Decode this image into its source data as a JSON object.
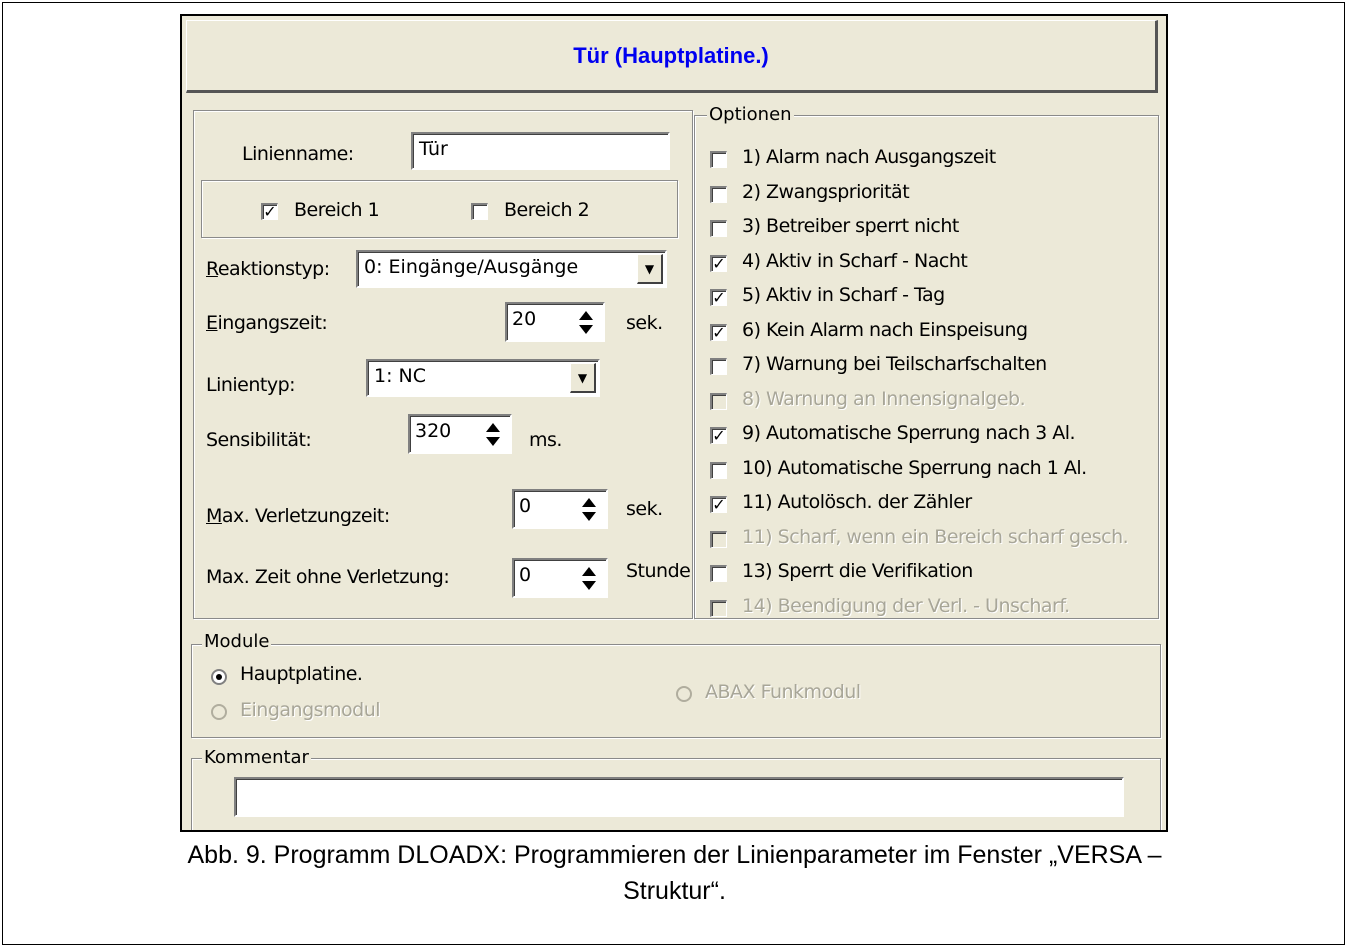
{
  "dialog": {
    "title": "Tür (Hauptplatine.)",
    "left": {
      "name_label": "Linienname:",
      "name_value": "Tür",
      "area1_label": "Bereich 1",
      "area1_checked": true,
      "area2_label": "Bereich 2",
      "area2_checked": false,
      "reaction_label_u": "R",
      "reaction_label_rest": "eaktionstyp:",
      "reaction_value": "0: Eingänge/Ausgänge",
      "entry_label_u": "E",
      "entry_label_rest": "ingangszeit:",
      "entry_value": "20",
      "entry_unit": "sek.",
      "linetype_label": "Linientyp:",
      "linetype_value": "1: NC",
      "sens_label": "Sensibilität:",
      "sens_value": "320",
      "sens_unit": "ms.",
      "maxviol_label_u": "M",
      "maxviol_label_rest": "ax. Verletzungzeit:",
      "maxviol_value": "0",
      "maxviol_unit": "sek.",
      "maxnoviol_label": "Max. Zeit ohne Verletzung:",
      "maxnoviol_value": "0",
      "maxnoviol_unit": "Stunde"
    },
    "options": {
      "legend": "Optionen",
      "items": [
        {
          "label": "1) Alarm nach Ausgangszeit",
          "checked": false,
          "enabled": true
        },
        {
          "label": "2) Zwangspriorität",
          "checked": false,
          "enabled": true
        },
        {
          "label": "3) Betreiber sperrt nicht",
          "checked": false,
          "enabled": true
        },
        {
          "label": "4) Aktiv in Scharf - Nacht",
          "checked": true,
          "enabled": true
        },
        {
          "label": "5) Aktiv in Scharf - Tag",
          "checked": true,
          "enabled": true
        },
        {
          "label": "6) Kein Alarm nach Einspeisung",
          "checked": true,
          "enabled": true
        },
        {
          "label": "7) Warnung bei Teilscharfschalten",
          "checked": false,
          "enabled": true
        },
        {
          "label": "8) Warnung an Innensignalgeb.",
          "checked": false,
          "enabled": false
        },
        {
          "label": "9) Automatische Sperrung nach 3 Al.",
          "checked": true,
          "enabled": true
        },
        {
          "label": "10) Automatische Sperrung nach 1 Al.",
          "checked": false,
          "enabled": true
        },
        {
          "label": "11) Autolösch. der Zähler",
          "checked": true,
          "enabled": true
        },
        {
          "label": "11) Scharf, wenn ein Bereich scharf gesch.",
          "checked": false,
          "enabled": false
        },
        {
          "label": "13) Sperrt die Verifikation",
          "checked": false,
          "enabled": true
        },
        {
          "label": "14) Beendigung der Verl. - Unscharf.",
          "checked": false,
          "enabled": false
        }
      ]
    },
    "module": {
      "legend": "Module",
      "main": "Hauptplatine.",
      "input": "Eingangsmodul",
      "abax": "ABAX Funkmodul"
    },
    "comment": {
      "legend": "Kommentar",
      "value": ""
    }
  },
  "caption": {
    "line1": "Abb. 9. Programm DLOADX: Programmieren der Linienparameter im Fenster „VERSA –",
    "line2": "Struktur“."
  }
}
